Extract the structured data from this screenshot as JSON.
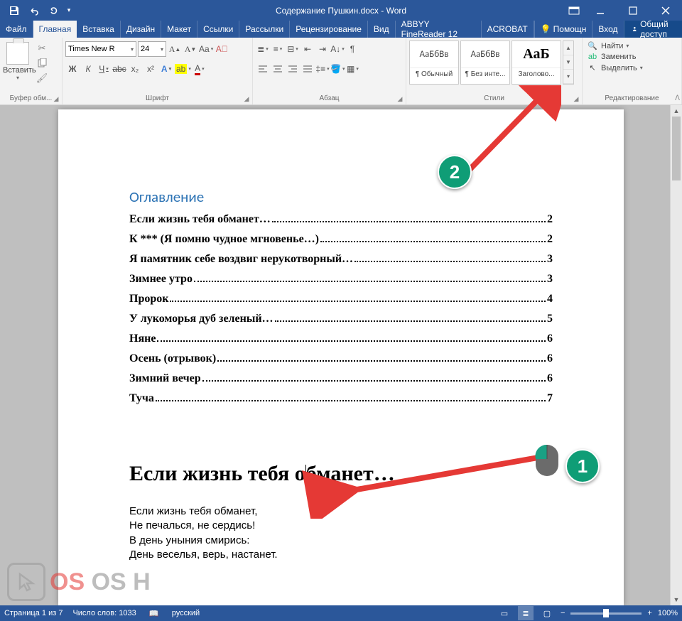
{
  "titlebar": {
    "title": "Содержание Пушкин.docx - Word"
  },
  "tabs": {
    "file": "Файл",
    "home": "Главная",
    "insert": "Вставка",
    "design": "Дизайн",
    "layout": "Макет",
    "references": "Ссылки",
    "mailings": "Рассылки",
    "review": "Рецензирование",
    "view": "Вид",
    "abbyy": "ABBYY FineReader 12",
    "acrobat": "ACROBAT",
    "help": "Помощн",
    "login": "Вход",
    "share": "Общий доступ"
  },
  "ribbon": {
    "clipboard": {
      "label": "Буфер обм...",
      "paste": "Вставить"
    },
    "font": {
      "label": "Шрифт",
      "name": "Times New R",
      "size": "24",
      "bold": "Ж",
      "italic": "К",
      "underline": "Ч",
      "strike": "abc",
      "sub": "x₂",
      "sup": "x²",
      "effects": "A",
      "highlight": "A",
      "color": "A",
      "grow": "A",
      "shrink": "A",
      "case": "Aa",
      "clear": "⨉"
    },
    "paragraph": {
      "label": "Абзац"
    },
    "styles": {
      "label": "Стили",
      "s1": {
        "preview": "АаБбВв",
        "name": "¶ Обычный"
      },
      "s2": {
        "preview": "АаБбВв",
        "name": "¶ Без инте..."
      },
      "s3": {
        "preview": "АаБ",
        "name": "Заголово..."
      }
    },
    "editing": {
      "label": "Редактирование",
      "find": "Найти",
      "replace": "Заменить",
      "select": "Выделить"
    }
  },
  "doc": {
    "toc_title": "Оглавление",
    "toc": [
      {
        "t": "Если жизнь тебя обманет…",
        "p": "2"
      },
      {
        "t": "К *** (Я помню чудное мгновенье…)",
        "p": "2"
      },
      {
        "t": "Я памятник себе воздвиг нерукотворный…",
        "p": "3"
      },
      {
        "t": "Зимнее утро",
        "p": "3"
      },
      {
        "t": "Пророк",
        "p": "4"
      },
      {
        "t": "У лукоморья дуб зеленый…",
        "p": "5"
      },
      {
        "t": "Няне",
        "p": "6"
      },
      {
        "t": "Осень (отрывок)",
        "p": "6"
      },
      {
        "t": "Зимний вечер",
        "p": "6"
      },
      {
        "t": "Туча",
        "p": "7"
      }
    ],
    "h1a": "Если жизнь тебя о",
    "h1b": "бманет…",
    "body1": "Если жизнь тебя обманет,",
    "body2": "Не печалься, не сердись!",
    "body3": "В день уныния смирись:",
    "body4": "День веселья, верь, настанет."
  },
  "status": {
    "page": "Страница 1 из 7",
    "words": "Число слов: 1033",
    "lang": "русский",
    "zoom": "100%"
  },
  "ann": {
    "n1": "1",
    "n2": "2"
  },
  "watermark": {
    "os": "OS H"
  }
}
